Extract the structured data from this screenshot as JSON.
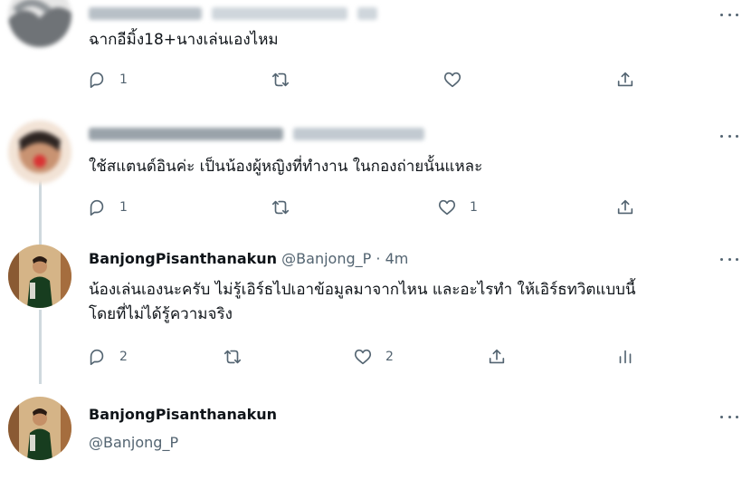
{
  "thread": [
    {
      "avatar": "blurred-user-avatar",
      "name_blurred": true,
      "text": "ฉากอีมิ้ง18+นางเล่นเองไหม",
      "actions": {
        "reply": {
          "icon": "reply-icon",
          "count": "1"
        },
        "retweet": {
          "icon": "retweet-icon",
          "count": ""
        },
        "like": {
          "icon": "heart-icon",
          "count": ""
        },
        "share": {
          "icon": "share-icon"
        }
      }
    },
    {
      "avatar": "blurred-user-avatar",
      "name_blurred": true,
      "text": "ใช้สแตนด์อินค่ะ เป็นน้องผู้หญิงที่ทำงาน ในกองถ่ายนั้นแหละ",
      "actions": {
        "reply": {
          "icon": "reply-icon",
          "count": "1"
        },
        "retweet": {
          "icon": "retweet-icon",
          "count": ""
        },
        "like": {
          "icon": "heart-icon",
          "count": "1"
        },
        "share": {
          "icon": "share-icon"
        }
      }
    },
    {
      "avatar": "banjong-avatar",
      "name": "BanjongPisanthanakun",
      "handle": "@Banjong_P",
      "separator": "·",
      "time": "4m",
      "text_line1": "น้องเล่นเองนะครับ ไม่รู้เอิร์ธไปเอาข้อมูลมาจากไหน และอะไรทำ ให้เอิร์ธทวิตแบบนี้",
      "text_line2": "โดยที่ไม่ได้รู้ความจริง",
      "actions": {
        "reply": {
          "icon": "reply-icon",
          "count": "2"
        },
        "retweet": {
          "icon": "retweet-icon",
          "count": ""
        },
        "like": {
          "icon": "heart-icon",
          "count": "2"
        },
        "share": {
          "icon": "share-icon"
        },
        "analytics": {
          "icon": "analytics-icon"
        }
      }
    },
    {
      "avatar": "banjong-avatar",
      "name": "BanjongPisanthanakun",
      "handle": "@Banjong_P"
    }
  ],
  "more_icon": "more-options-icon",
  "colors": {
    "text": "#0f1419",
    "secondary": "#536471",
    "thread_line": "#cfd9de",
    "background": "#ffffff"
  }
}
